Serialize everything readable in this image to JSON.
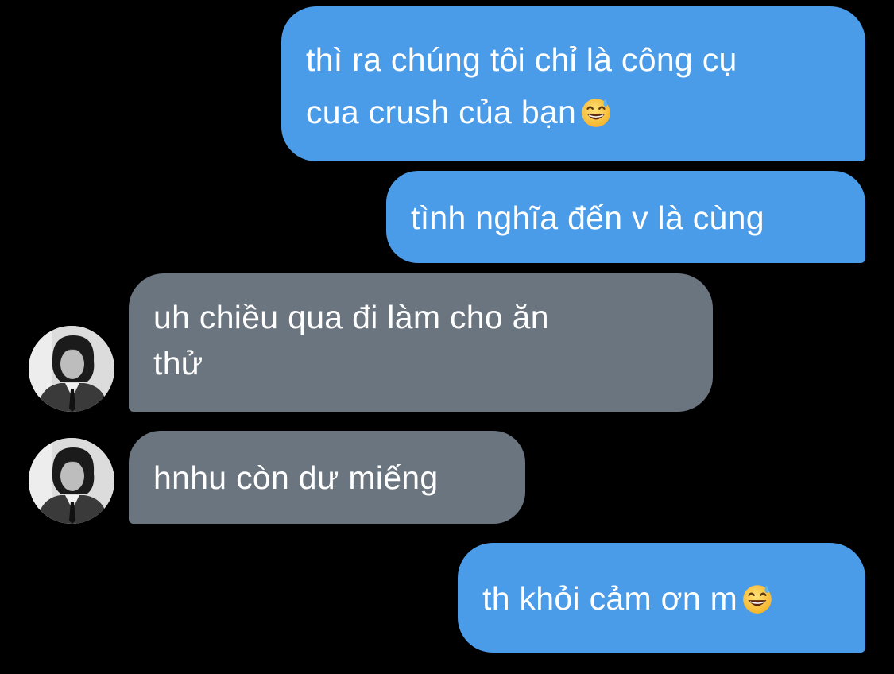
{
  "messages": [
    {
      "id": "msg-1",
      "direction": "outgoing",
      "lines": [
        "thì ra chúng tôi chỉ là công cụ",
        "cua crush của bạn"
      ],
      "emoji": "grinning-face-with-sweat-icon"
    },
    {
      "id": "msg-2",
      "direction": "outgoing",
      "lines": [
        "tình nghĩa đến v là cùng"
      ]
    },
    {
      "id": "msg-3",
      "direction": "incoming",
      "lines": [
        "uh chiều qua đi làm cho ăn",
        "thử"
      ],
      "avatar": "contact-avatar"
    },
    {
      "id": "msg-4",
      "direction": "incoming",
      "lines": [
        "hnhu còn dư miếng"
      ],
      "avatar": "contact-avatar"
    },
    {
      "id": "msg-5",
      "direction": "outgoing",
      "lines": [
        "th khỏi cảm ơn m"
      ],
      "emoji": "grinning-face-with-sweat-icon"
    }
  ],
  "colors": {
    "background": "#000000",
    "outgoing_bubble": "#4a9be8",
    "incoming_bubble": "#6b7580",
    "text": "#ffffff"
  }
}
